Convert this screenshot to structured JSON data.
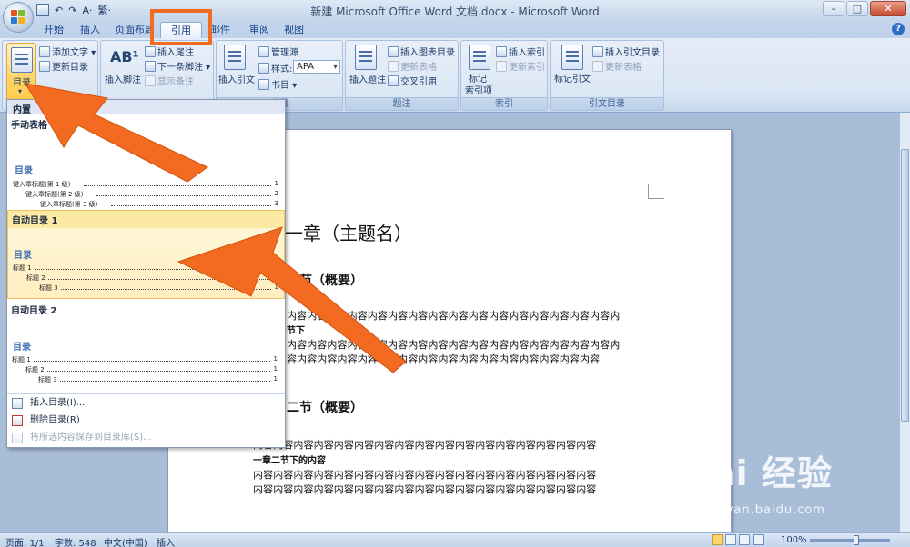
{
  "window": {
    "title": "新建 Microsoft Office Word 文档.docx - Microsoft Word",
    "qat_undo": "↶",
    "qat_redo": "↷",
    "qat_format": "A·",
    "qat_custom": "繁·"
  },
  "tabs": [
    {
      "label": "开始"
    },
    {
      "label": "插入"
    },
    {
      "label": "页面布局"
    },
    {
      "label": "引用"
    },
    {
      "label": "邮件"
    },
    {
      "label": "审阅"
    },
    {
      "label": "视图"
    }
  ],
  "ribbon": {
    "toc": {
      "button_label": "目录",
      "add_text": "添加文字",
      "update_toc": "更新目录"
    },
    "footnotes": {
      "insert_footnote": "插入脚注",
      "insert_endnote": "插入尾注",
      "next_footnote": "下一条脚注",
      "show_notes": "显示备注"
    },
    "citations": {
      "insert_citation": "插入引文",
      "manage_sources": "管理源",
      "style_label": "样式:",
      "style_value": "APA",
      "bibliography": "书目",
      "group_label": "书目"
    },
    "captions": {
      "insert_caption": "插入题注",
      "insert_table_of_figures": "插入图表目录",
      "update_table": "更新表格",
      "cross_reference": "交叉引用",
      "group_label": "题注"
    },
    "index": {
      "mark_entry": "标记",
      "mark_entry_line2": "索引项",
      "insert_index": "插入索引",
      "update_index": "更新索引",
      "group_label": "索引"
    },
    "toa": {
      "mark_citation": "标记引文",
      "insert_toa": "插入引文目录",
      "update_table": "更新表格",
      "group_label": "引文目录"
    }
  },
  "gallery": {
    "header": "内置",
    "manual": {
      "title": "手动表格",
      "toc_title": "目录",
      "lines": [
        {
          "text": "键入章标题(第 1 级)",
          "page": "1"
        },
        {
          "text": "键入章标题(第 2 级)",
          "page": "2"
        },
        {
          "text": "键入章标题(第 3 级)",
          "page": "3"
        }
      ]
    },
    "auto1": {
      "title": "自动目录 1",
      "toc_title": "目录",
      "lines": [
        {
          "text": "标题 1",
          "page": "1"
        },
        {
          "text": "标题 2",
          "page": "1"
        },
        {
          "text": "标题 3",
          "page": "1"
        }
      ]
    },
    "auto2": {
      "title": "自动目录 2",
      "toc_title": "目录",
      "lines": [
        {
          "text": "标题 1",
          "page": "1"
        },
        {
          "text": "标题 2",
          "page": "1"
        },
        {
          "text": "标题 3",
          "page": "1"
        }
      ]
    },
    "menu": [
      {
        "label": "插入目录(I)..."
      },
      {
        "label": "删除目录(R)"
      },
      {
        "label": "将所选内容保存到目录库(S)..."
      }
    ]
  },
  "document": {
    "chapter_title": "一章（主题名）",
    "section1": "一节（概要）",
    "para_line": "内容内容内容内容内容内容内容内容内容内容内容内容内容内容内容内容内",
    "para_line2": "内容内容内容内容内容内容内容内容内容内容内容内容内容内容内容内容内",
    "para_line3": "容内容内容内容内容内容内容内容内容内容内容内容内容内容内容内容",
    "subsection_partial": "节下",
    "section2": "二节（概要）",
    "para_line4": "内容内容内容内容内容内容内容内容内容内容内容内容内容内容内容内容内容",
    "subsection2": "一章二节下的内容",
    "para_line5": "内容内容内容内容内容内容内容内容内容内容内容内容内容内容内容内容内容",
    "para_line6": "内容内容内容内容内容内容内容内容内容内容内容内容内容内容内容内容内容"
  },
  "status": {
    "page": "页面: 1/1",
    "words": "字数: 548",
    "language": "中文(中国)",
    "mode": "插入",
    "zoom": "100%"
  },
  "watermark": {
    "brand": "Bai 经验",
    "url": "jingyan.baidu.com"
  },
  "colors": {
    "accent_orange": "#f36a21",
    "ribbon_blue": "#15428b"
  }
}
